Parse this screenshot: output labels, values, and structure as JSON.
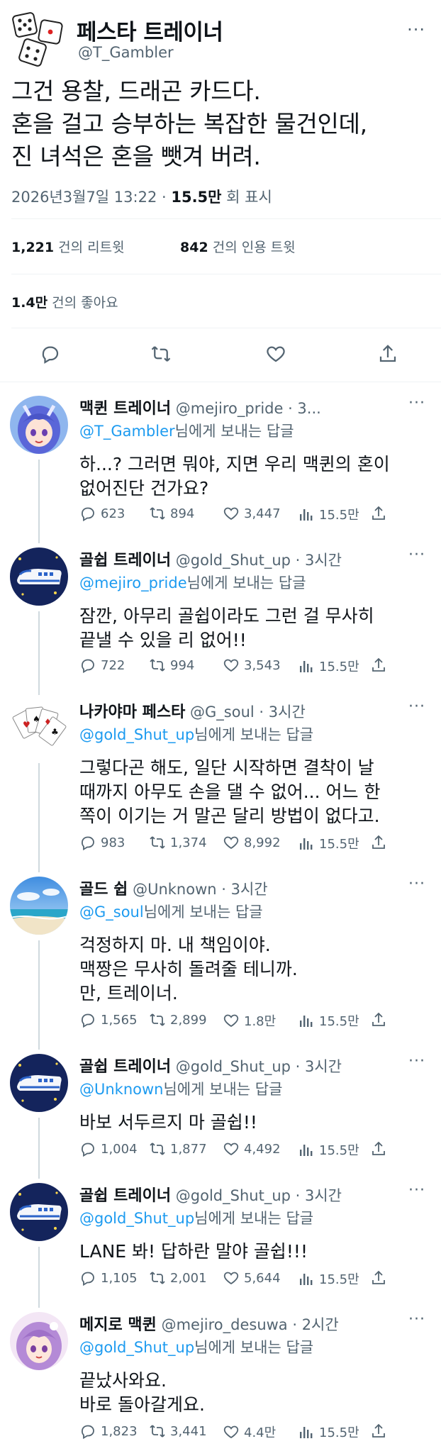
{
  "tweet": {
    "author_name": "페스타 트레이너",
    "author_handle": "@T_Gambler",
    "text": "그건 용찰, 드래곤 카드다.\n혼을 걸고 승부하는 복잡한 물건인데,\n진 녀석은 혼을 뺏겨 버려.",
    "timestamp": "2026년3월7일 13:22 · ",
    "views_count": "15.5만",
    "views_label": " 회 표시",
    "retweets_count": "1,221",
    "retweets_label": " 건의 리트윗",
    "quotes_count": "842",
    "quotes_label": " 건의 인용 트윗",
    "likes_count": "1.4만",
    "likes_label": " 건의 좋아요",
    "more_label": "···"
  },
  "replies": [
    {
      "name": "맥퀸 트레이너",
      "handle": "@mejiro_pride · 3...",
      "reply_to": "@T_Gambler",
      "reply_suffix": "님에게 보내는 답글",
      "text": "하...? 그러면 뭐야, 지면 우리 맥퀸의 혼이\n없어진단 건가요?",
      "comments": "623",
      "retweets": "894",
      "likes": "3,447",
      "views": "15.5만",
      "avatar": "anime-girl-blue"
    },
    {
      "name": "골쉽 트레이너",
      "handle": "@gold_Shut_up · 3시간",
      "reply_to": "@mejiro_pride",
      "reply_suffix": "님에게 보내는 답글",
      "text": "잠깐, 아무리 골쉽이라도 그런 걸 무사히\n끝낼 수 있을 리 없어!!",
      "comments": "722",
      "retweets": "994",
      "likes": "3,543",
      "views": "15.5만",
      "avatar": "bullet-train"
    },
    {
      "name": "나카야마 페스타",
      "handle": "@G_soul · 3시간",
      "reply_to": "@gold_Shut_up",
      "reply_suffix": "님에게 보내는 답글",
      "text": "그렇다곤 해도, 일단 시작하면 결착이 날\n때까지 아무도 손을 댈 수 없어... 어느 한\n쪽이 이기는 거 말곤 달리 방법이 없다고.",
      "comments": "983",
      "retweets": "1,374",
      "likes": "8,992",
      "views": "15.5만",
      "avatar": "playing-cards"
    },
    {
      "name": "골드 쉽",
      "handle": "@Unknown · 3시간",
      "reply_to": "@G_soul",
      "reply_suffix": "님에게 보내는 답글",
      "text": "걱정하지 마. 내 책임이야.\n맥짱은 무사히 돌려줄 테니까.\n만, 트레이너.",
      "comments": "1,565",
      "retweets": "2,899",
      "likes": "1.8만",
      "views": "15.5만",
      "avatar": "beach"
    },
    {
      "name": "골쉽 트레이너",
      "handle": "@gold_Shut_up · 3시간",
      "reply_to": "@Unknown",
      "reply_suffix": "님에게 보내는 답글",
      "text": "바보 서두르지 마 골쉽!!",
      "comments": "1,004",
      "retweets": "1,877",
      "likes": "4,492",
      "views": "15.5만",
      "avatar": "bullet-train"
    },
    {
      "name": "골쉽 트레이너",
      "handle": "@gold_Shut_up · 3시간",
      "reply_to": "@gold_Shut_up",
      "reply_suffix": "님에게 보내는 답글",
      "text": "LANE 봐! 답하란 말야 골쉽!!!",
      "comments": "1,105",
      "retweets": "2,001",
      "likes": "5,644",
      "views": "15.5만",
      "avatar": "bullet-train"
    },
    {
      "name": "메지로 맥퀸",
      "handle": "@mejiro_desuwa · 2시간",
      "reply_to": "@gold_Shut_up",
      "reply_suffix": "님에게 보내는 답글",
      "text": "끝났사와요.\n바로 돌아갈게요.",
      "comments": "1,823",
      "retweets": "3,441",
      "likes": "4.4만",
      "views": "15.5만",
      "avatar": "anime-girl-purple"
    }
  ],
  "icons": {
    "comment": "comment-icon",
    "retweet": "retweet-icon",
    "like": "heart-icon",
    "views": "views-icon",
    "share": "share-icon"
  },
  "colors": {
    "link": "#1d9bf0",
    "secondary": "#536471",
    "text": "#0f1419",
    "divider": "#eff3f4",
    "thread_line": "#cfd9de"
  }
}
